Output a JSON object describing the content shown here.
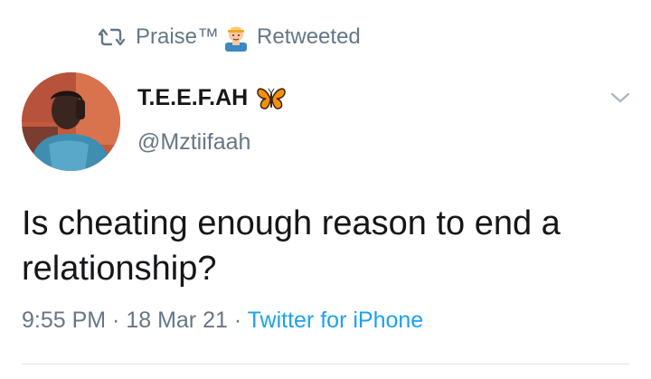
{
  "retweet": {
    "icon": "retweet-icon",
    "name": "Praise™",
    "emoji": "man-technologist-emoji",
    "label": "Retweeted"
  },
  "author": {
    "display_name": "T.E.E.F.AH",
    "badge_emoji": "butterfly-emoji",
    "handle": "@Mztiifaah",
    "avatar": "profile-photo"
  },
  "menu": {
    "icon": "chevron-down-icon"
  },
  "tweet": {
    "text": "Is cheating enough reason to end a relationship?"
  },
  "meta": {
    "time": "9:55 PM",
    "separator1": " · ",
    "date": "18 Mar 21",
    "separator2": " · ",
    "source": "Twitter for iPhone"
  },
  "colors": {
    "secondary_text": "#657786",
    "link": "#1da1f2",
    "primary_text": "#14171a",
    "divider": "#e1e8ed"
  }
}
